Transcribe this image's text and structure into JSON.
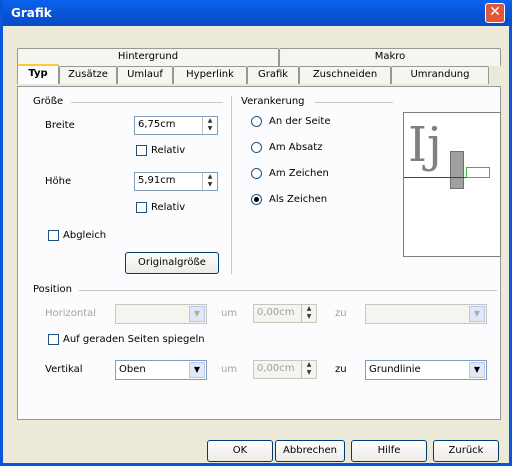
{
  "window": {
    "title": "Grafik",
    "close_glyph": "✕"
  },
  "tabs_back": [
    "Hintergrund",
    "Makro"
  ],
  "tabs_front": [
    "Typ",
    "Zusätze",
    "Umlauf",
    "Hyperlink",
    "Grafik",
    "Zuschneiden",
    "Umrandung"
  ],
  "groesse": {
    "heading": "Größe",
    "breite_label": "Breite",
    "breite_value": "6,75cm",
    "relativ1": "Relativ",
    "hoehe_label": "Höhe",
    "hoehe_value": "5,91cm",
    "relativ2": "Relativ",
    "abgleich": "Abgleich",
    "original_button": "Originalgröße"
  },
  "verankerung": {
    "heading": "Verankerung",
    "options": [
      "An der Seite",
      "Am Absatz",
      "Am Zeichen",
      "Als Zeichen"
    ],
    "selected": "Als Zeichen"
  },
  "preview": {
    "letters": "Ij"
  },
  "position": {
    "heading": "Position",
    "horizontal_label": "Horizontal",
    "horizontal_value": "",
    "um1": "um",
    "h_spin": "0,00cm",
    "zu1": "zu",
    "zu1_value": "",
    "spiegeln": "Auf geraden Seiten spiegeln",
    "vertikal_label": "Vertikal",
    "vertikal_value": "Oben",
    "um2": "um",
    "v_spin": "0,00cm",
    "zu2": "zu",
    "zu2_value": "Grundlinie"
  },
  "buttons": {
    "ok": "OK",
    "cancel": "Abbrechen",
    "help": "Hilfe",
    "back": "Zurück"
  }
}
